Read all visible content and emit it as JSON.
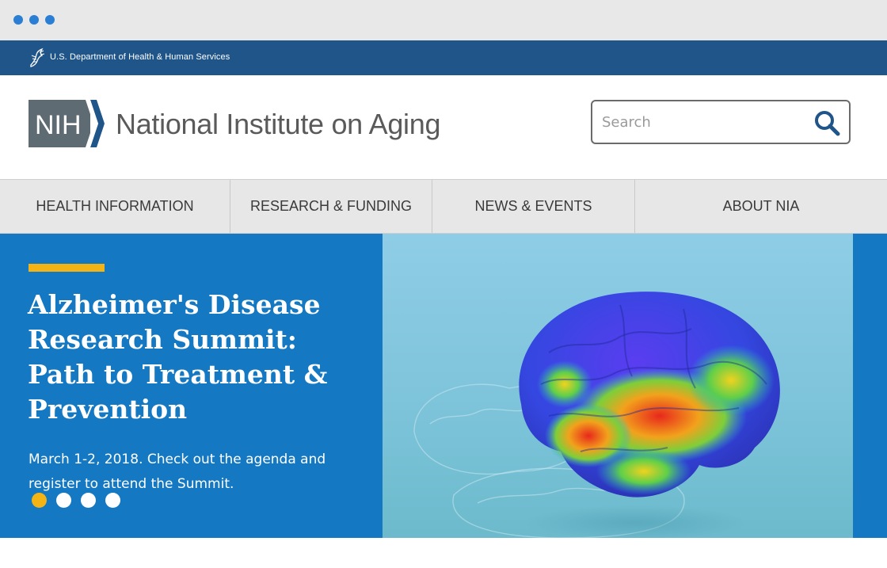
{
  "hhs": {
    "text": "U.S. Department of Health & Human Services"
  },
  "header": {
    "logo_text": "NIH",
    "title": "National Institute on Aging"
  },
  "search": {
    "placeholder": "Search",
    "value": ""
  },
  "nav": {
    "items": [
      {
        "label": "HEALTH INFORMATION"
      },
      {
        "label": "RESEARCH & FUNDING"
      },
      {
        "label": "NEWS & EVENTS"
      },
      {
        "label": "ABOUT NIA"
      }
    ]
  },
  "hero": {
    "title": "Alzheimer's Disease Research Summit: Path to Treatment & Prevention",
    "text": "March 1-2, 2018. Check out the agenda and register to attend the Summit.",
    "slides_total": 4,
    "active_slide": 1
  },
  "colors": {
    "hhs_bar": "#20558a",
    "hero_bg": "#1478c2",
    "accent": "#f5b416",
    "nav_bg": "#e7e7e7",
    "chrome_dot": "#2a7fd4"
  },
  "icons": {
    "hhs": "hhs-eagle-icon",
    "search": "search-icon"
  }
}
